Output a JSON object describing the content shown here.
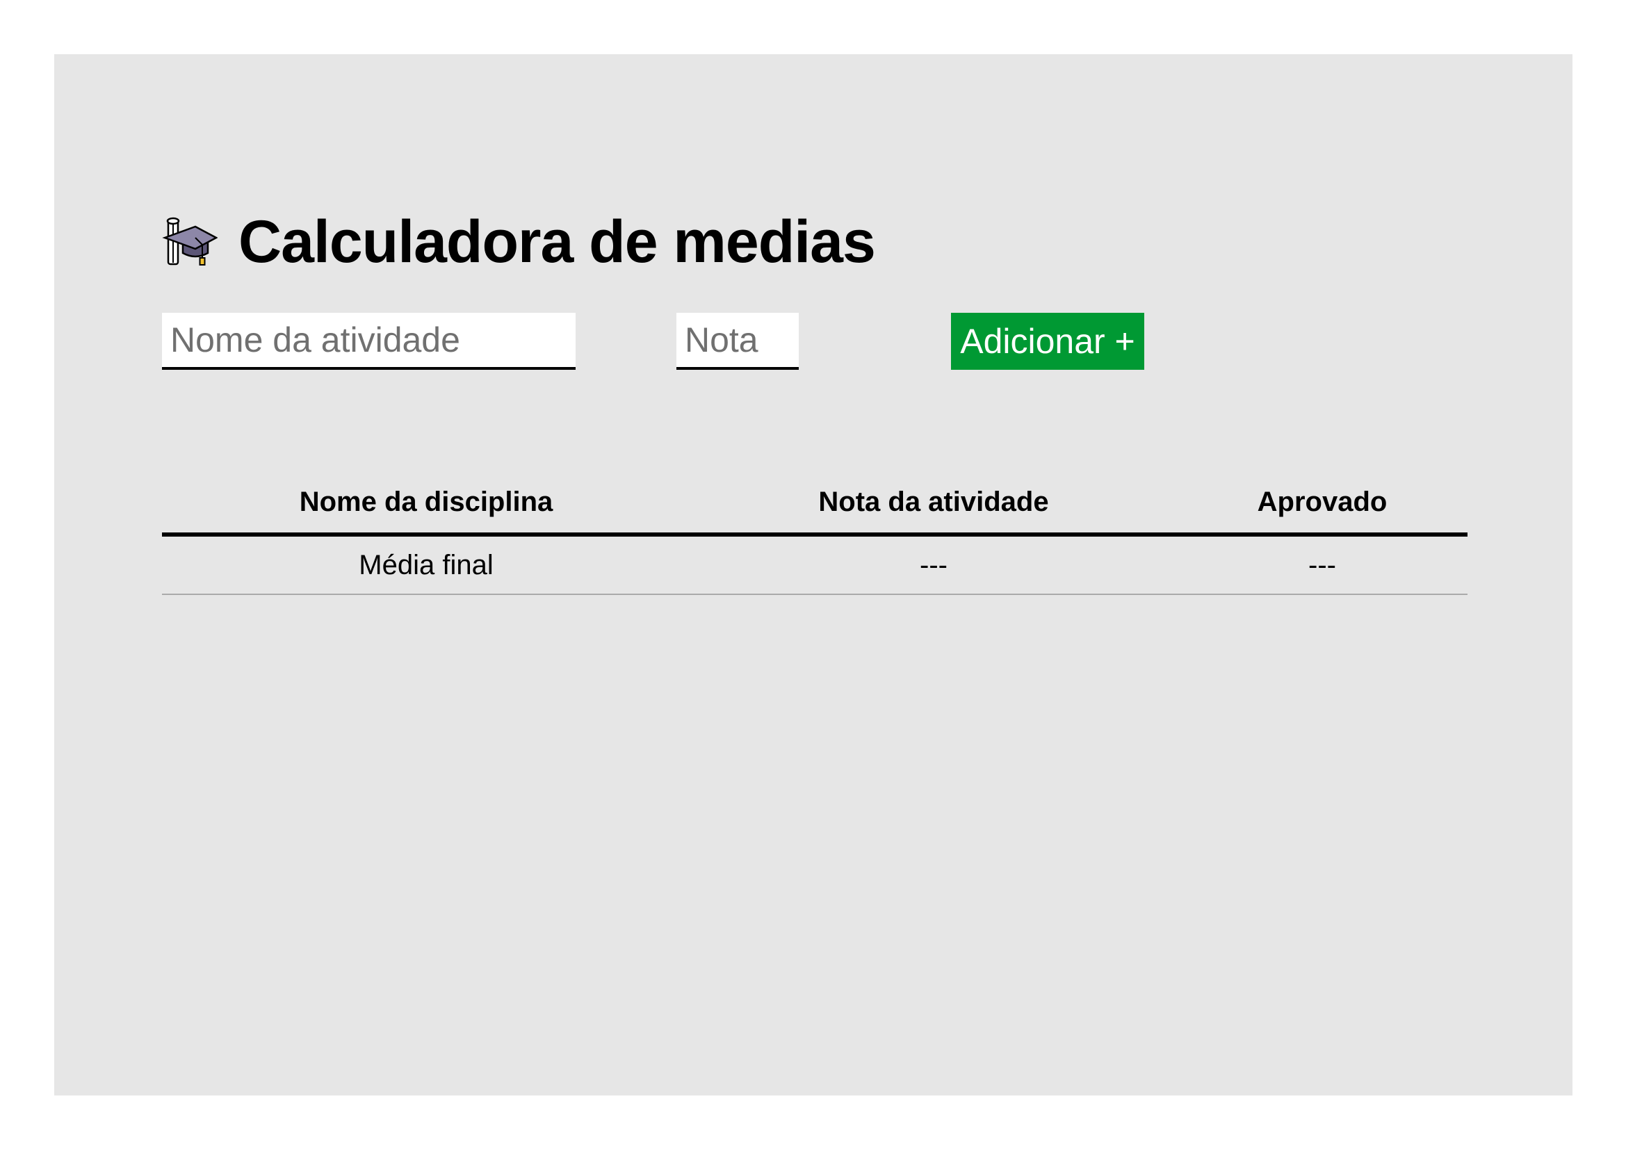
{
  "header": {
    "icon": "graduation-cap-icon",
    "title": "Calculadora de medias"
  },
  "form": {
    "activity_name_placeholder": "Nome da atividade",
    "activity_name_value": "",
    "grade_placeholder": "Nota",
    "grade_value": "",
    "add_button_label": "Adicionar +"
  },
  "colors": {
    "page_background": "#e6e6e6",
    "button_background": "#009933",
    "button_text": "#ffffff"
  },
  "table": {
    "columns": [
      "Nome da disciplina",
      "Nota da atividade",
      "Aprovado"
    ],
    "footer_row": [
      "Média final",
      "---",
      "---"
    ]
  }
}
